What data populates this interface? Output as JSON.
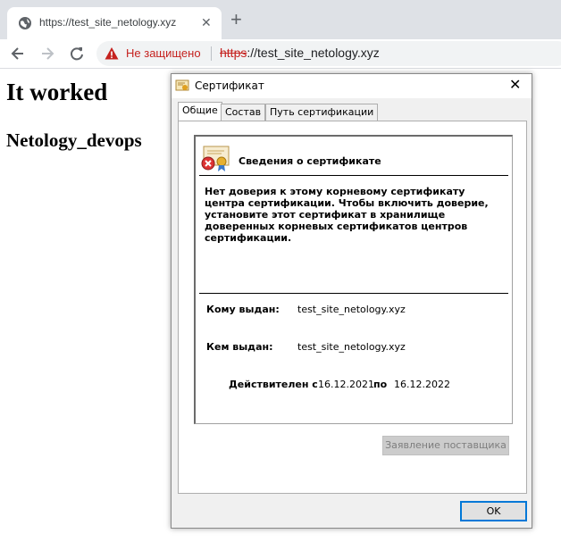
{
  "browser": {
    "tab_title": "https://test_site_netology.xyz",
    "tab_close": "✕",
    "new_tab": "+",
    "insecure_label": "Не защищено",
    "url_scheme": "https",
    "url_rest": "://test_site_netology.xyz"
  },
  "page": {
    "heading": "It worked",
    "subheading": "Netology_devops"
  },
  "dialog": {
    "title": "Сертификат",
    "close": "✕",
    "tabs": [
      "Общие",
      "Состав",
      "Путь сертификации"
    ],
    "active_tab": 0,
    "info_heading": "Сведения о сертификате",
    "warning": "Нет доверия к этому корневому сертификату центра сертификации. Чтобы включить  доверие, установите этот сертификат в хранилище доверенных корневых сертификатов центров сертификации.",
    "issued_to_label": "Кому выдан:",
    "issued_to": "test_site_netology.xyz",
    "issued_by_label": "Кем выдан:",
    "issued_by": "test_site_netology.xyz",
    "valid_from_label": "Действителен с",
    "valid_from": "16.12.2021",
    "valid_to_label": "по",
    "valid_to": "16.12.2022",
    "issuer_statement_button": "Заявление поставщика",
    "ok_button": "OK"
  },
  "colors": {
    "insecure": "#c5221f",
    "focus": "#0078d7"
  }
}
